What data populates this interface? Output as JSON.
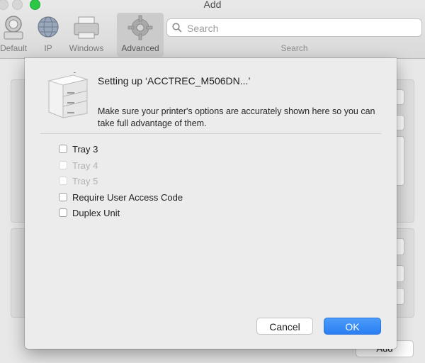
{
  "window": {
    "title": "Add"
  },
  "toolbar": {
    "items": [
      {
        "label": "Default",
        "icon": "default-printer-icon"
      },
      {
        "label": "IP",
        "icon": "globe-icon"
      },
      {
        "label": "Windows",
        "icon": "windows-printer-icon"
      },
      {
        "label": "Advanced",
        "icon": "gear-icon",
        "active": true
      }
    ],
    "search": {
      "placeholder": "Search",
      "value": "",
      "caption": "Search"
    }
  },
  "background": {
    "add_button_label": "Add"
  },
  "dialog": {
    "title": "Setting up ‘ACCTREC_M506DN...’",
    "description": "Make sure your printer's options are accurately shown here so you can take full advantage of them.",
    "options": [
      {
        "label": "Tray 3",
        "checked": false,
        "enabled": true
      },
      {
        "label": "Tray 4",
        "checked": false,
        "enabled": false
      },
      {
        "label": "Tray 5",
        "checked": false,
        "enabled": false
      },
      {
        "label": "Require User Access Code",
        "checked": false,
        "enabled": true
      },
      {
        "label": "Duplex Unit",
        "checked": false,
        "enabled": true
      }
    ],
    "cancel_label": "Cancel",
    "ok_label": "OK"
  },
  "colors": {
    "accent": "#2b7ef2",
    "close_button": "#2ac845"
  }
}
